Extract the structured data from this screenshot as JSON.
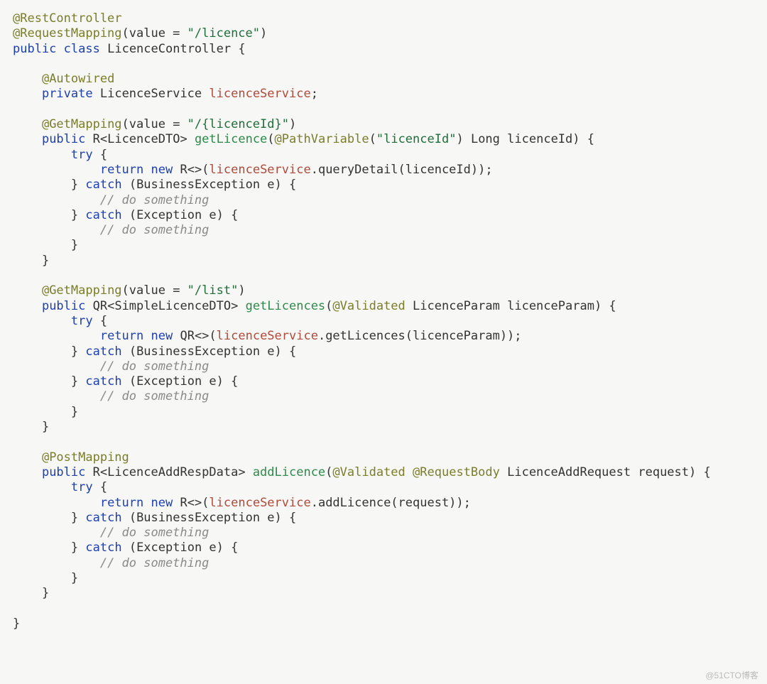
{
  "watermark": "@51CTO博客",
  "t": {
    "a_RestController": "@RestController",
    "a_RequestMapping": "@RequestMapping",
    "requestMapping_args": "(value = ",
    "requestMapping_str": "\"/licence\"",
    "requestMapping_close": ")",
    "kw_public": "public",
    "kw_class": "class",
    "className": "LicenceController",
    "brace_open": " {",
    "a_Autowired": "@Autowired",
    "kw_private": "private",
    "type_LicenceService": "LicenceService",
    "field_licenceService": "licenceService",
    "semi": ";",
    "a_GetMapping": "@GetMapping",
    "getLicence_val_open": "(value = ",
    "getLicence_val_str": "\"/{licenceId}\"",
    "getLicence_val_close": ")",
    "type_R_LicenceDTO": "R<LicenceDTO>",
    "m_getLicence": "getLicence",
    "paren_open": "(",
    "a_PathVariable": "@PathVariable",
    "pathVar_str": "\"licenceId\"",
    "type_Long": "Long",
    "param_licenceId": "licenceId",
    "paren_close_brace": ") {",
    "kw_try": "try",
    "kw_return": "return",
    "kw_new": "new",
    "Rnew_open": "R<>(",
    "dot_queryDetail": ".queryDetail(licenceId));",
    "kw_catch": "catch",
    "catch_BusinessException": "(BusinessException e) {",
    "cmt_do_something": "// do something",
    "catch_Exception": "(Exception e) {",
    "brace_close": "}",
    "getLicences_val_str": "\"/list\"",
    "type_QR_SimpleLicenceDTO": "QR<SimpleLicenceDTO>",
    "m_getLicences": "getLicences",
    "a_Validated": "@Validated",
    "type_LicenceParam": "LicenceParam",
    "param_licenceParam": "licenceParam",
    "QRnew_open": "QR<>(",
    "dot_getLicences": ".getLicences(licenceParam));",
    "a_PostMapping": "@PostMapping",
    "type_R_LicenceAddRespData": "R<LicenceAddRespData>",
    "m_addLicence": "addLicence",
    "a_RequestBody": "@RequestBody",
    "type_LicenceAddRequest": "LicenceAddRequest",
    "param_request": "request",
    "dot_addLicence": ".addLicence(request));",
    "space": " ",
    "close_paren": ")",
    "brace_only_open": "{"
  }
}
